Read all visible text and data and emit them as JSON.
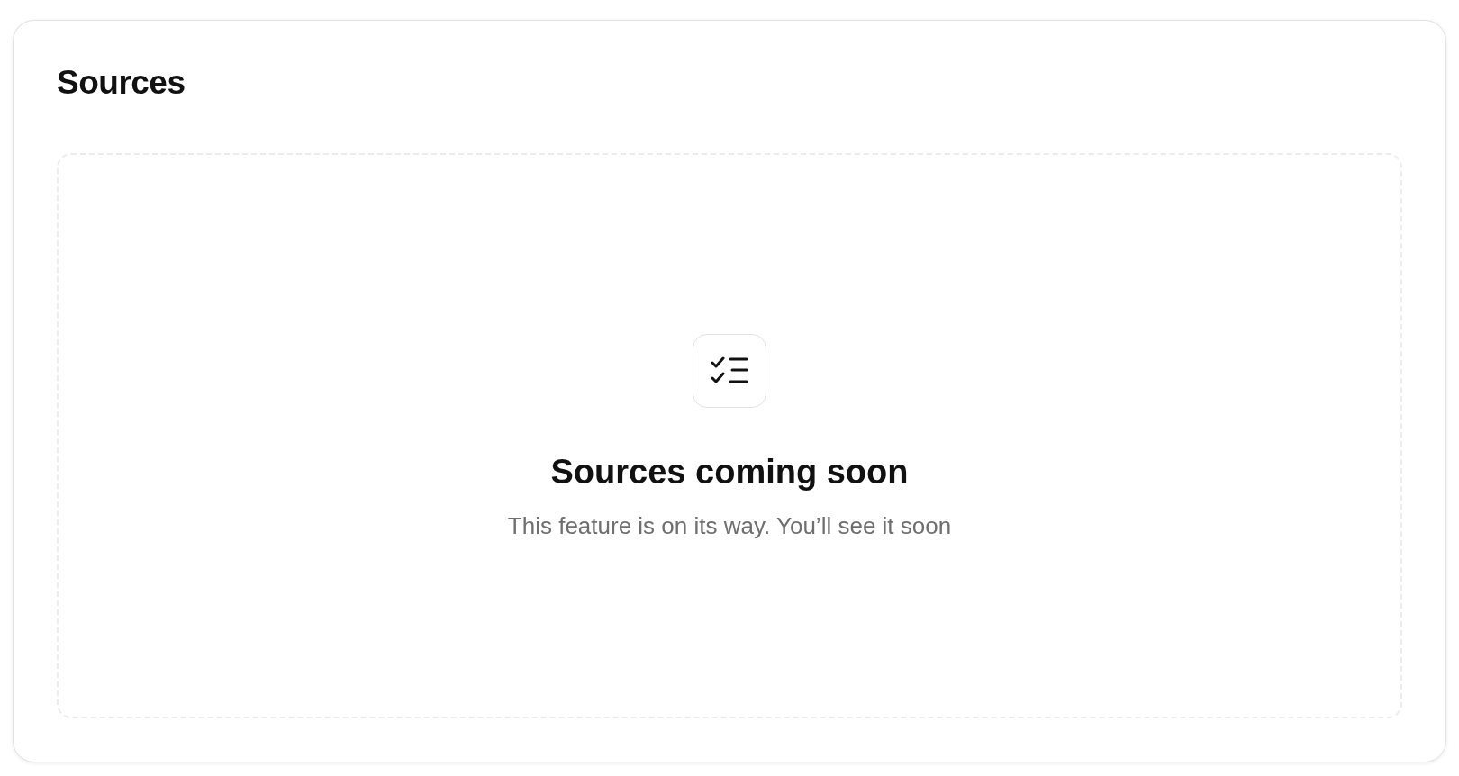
{
  "card": {
    "title": "Sources"
  },
  "empty_state": {
    "heading": "Sources coming soon",
    "message": "This feature is on its way. You’ll see it soon"
  }
}
